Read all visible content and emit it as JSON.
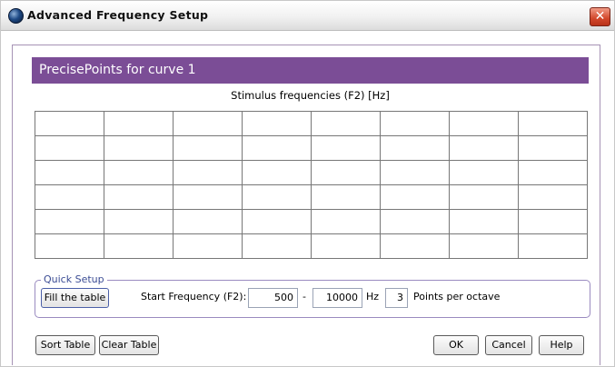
{
  "window": {
    "title": "Advanced Frequency Setup"
  },
  "header": {
    "title": "PrecisePoints for curve 1"
  },
  "table": {
    "caption": "Stimulus frequencies (F2) [Hz]",
    "rows": 6,
    "cols": 8
  },
  "quick_setup": {
    "legend": "Quick Setup",
    "fill_label": "Fill the table",
    "start_label": "Start Frequency (F2):",
    "start_value": "500",
    "dash": "-",
    "end_value": "10000",
    "unit": "Hz",
    "points_value": "3",
    "points_label": "Points per octave"
  },
  "buttons": {
    "sort": "Sort Table",
    "clear": "Clear Table",
    "ok": "OK",
    "cancel": "Cancel",
    "help": "Help"
  },
  "icons": {
    "close": "close-icon",
    "app": "app-globe-icon"
  },
  "colors": {
    "header_band": "#7b4d96",
    "close": "#d2472a"
  }
}
